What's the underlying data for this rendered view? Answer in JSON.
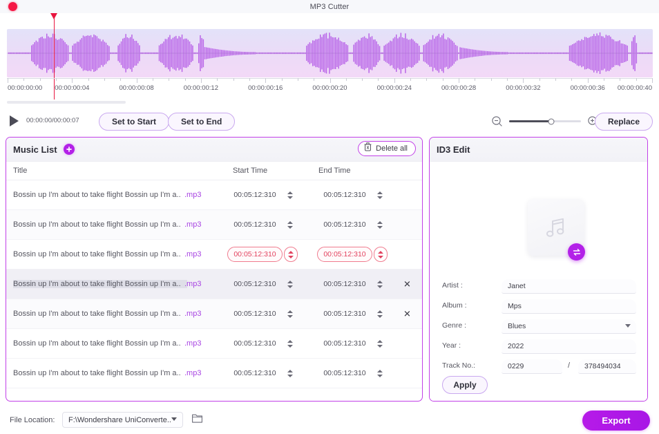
{
  "window": {
    "title": "MP3 Cutter",
    "record_indicator": "record-dot"
  },
  "timeline": {
    "ticks": [
      "00:00:00:00",
      "00:00:00:04",
      "00:00:00:08",
      "00:00:00:12",
      "00:00:00:16",
      "00:00:00:20",
      "00:00:00:24",
      "00:00:00:28",
      "00:00:00:32",
      "00:00:00:36",
      "00:00:00:40"
    ],
    "playhead_label": "playhead"
  },
  "transport": {
    "play_icon": "play-icon",
    "time_readout": "00:00:00/00:00:07",
    "set_to_start": "Set to Start",
    "set_to_end": "Set to End",
    "replace": "Replace",
    "zoom_out_icon": "zoom-out-icon",
    "zoom_in_icon": "zoom-in-icon",
    "zoom_value": 59
  },
  "music_list": {
    "panel_title": "Music List",
    "add_icon": "plus-icon",
    "delete_all": "Delete all",
    "delete_all_icon": "trash-icon",
    "columns": {
      "title": "Title",
      "start_time": "Start Time",
      "end_time": "End Time"
    },
    "rows": [
      {
        "title": "Bossin up I'm about to take flight Bossin up I'm a..",
        "ext": ".mp3",
        "start": "00:05:12:310",
        "end": "00:05:12:310",
        "state": "normal",
        "removable": false
      },
      {
        "title": "Bossin up I'm about to take flight Bossin up I'm a..",
        "ext": ".mp3",
        "start": "00:05:12:310",
        "end": "00:05:12:310",
        "state": "alt",
        "removable": false
      },
      {
        "title": "Bossin up I'm about to take flight Bossin up I'm a..",
        "ext": ".mp3",
        "start": "00:05:12:310",
        "end": "00:05:12:310",
        "state": "error",
        "removable": false
      },
      {
        "title": "Bossin up I'm about to take flight Bossin up I'm a..",
        "ext": ".mp3",
        "start": "00:05:12:310",
        "end": "00:05:12:310",
        "state": "selected",
        "removable": true
      },
      {
        "title": "Bossin up I'm about to take flight Bossin up I'm a..",
        "ext": ".mp3",
        "start": "00:05:12:310",
        "end": "00:05:12:310",
        "state": "alt",
        "removable": true
      },
      {
        "title": "Bossin up I'm about to take flight Bossin up I'm a..",
        "ext": ".mp3",
        "start": "00:05:12:310",
        "end": "00:05:12:310",
        "state": "normal",
        "removable": false
      },
      {
        "title": "Bossin up I'm about to take flight Bossin up I'm a..",
        "ext": ".mp3",
        "start": "00:05:12:310",
        "end": "00:05:12:310",
        "state": "normal",
        "removable": false
      }
    ],
    "remove_icon": "close-icon"
  },
  "id3": {
    "panel_title": "ID3 Edit",
    "cover_icon": "music-note-icon",
    "cover_swap_icon": "swap-icon",
    "fields": {
      "artist_label": "Artist :",
      "artist_value": "Janet",
      "album_label": "Album :",
      "album_value": "Mps",
      "genre_label": "Genre :",
      "genre_value": "Blues",
      "year_label": "Year :",
      "year_value": "2022",
      "track_label": "Track No.:",
      "track_value": "0229",
      "track_separator": "/",
      "track_total": "378494034"
    },
    "apply": "Apply"
  },
  "bottom": {
    "file_location_label": "File Location:",
    "file_location_value": "F:\\Wondershare UniConverte..",
    "folder_icon": "folder-icon",
    "export": "Export"
  },
  "colors": {
    "accent": "#b321e8",
    "panel_border": "#c13fe8",
    "error": "#e2415e",
    "playhead": "#e8153f",
    "waveform": "#b965e8"
  }
}
